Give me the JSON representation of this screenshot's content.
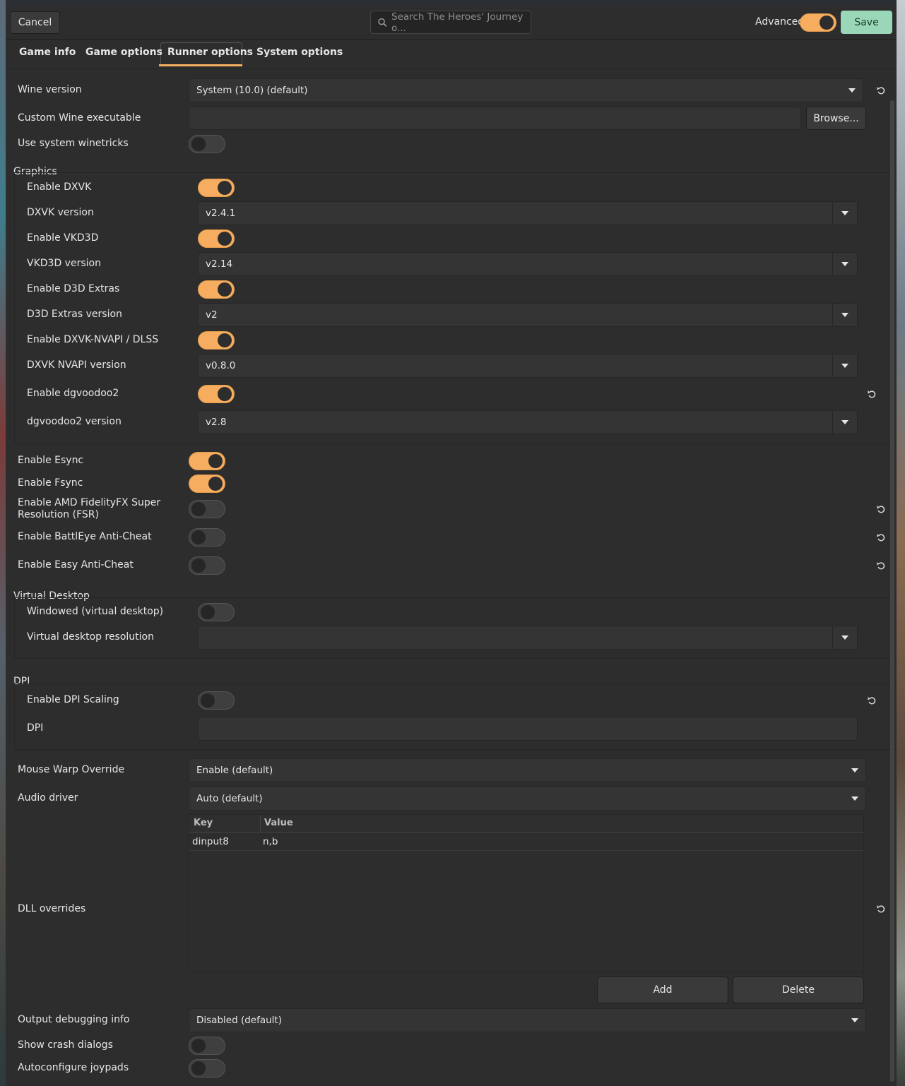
{
  "header": {
    "cancel_label": "Cancel",
    "search_placeholder": "Search The Heroes' Journey o...",
    "advanced_label": "Advanced",
    "advanced_on": true,
    "save_label": "Save"
  },
  "tabs": [
    {
      "label": "Game info"
    },
    {
      "label": "Game options"
    },
    {
      "label": "Runner options",
      "active": true
    },
    {
      "label": "System options"
    }
  ],
  "runner": {
    "wine_version_label": "Wine version",
    "wine_version_value": "System (10.0) (default)",
    "custom_wine_label": "Custom Wine executable",
    "custom_wine_value": "",
    "browse_label": "Browse...",
    "system_winetricks_label": "Use system winetricks",
    "system_winetricks_on": false
  },
  "graphics": {
    "title": "Graphics",
    "enable_dxvk_label": "Enable DXVK",
    "enable_dxvk_on": true,
    "dxvk_version_label": "DXVK version",
    "dxvk_version_value": "v2.4.1",
    "enable_vkd3d_label": "Enable VKD3D",
    "enable_vkd3d_on": true,
    "vkd3d_version_label": "VKD3D version",
    "vkd3d_version_value": "v2.14",
    "enable_d3d_extras_label": "Enable D3D Extras",
    "enable_d3d_extras_on": true,
    "d3d_extras_version_label": "D3D Extras version",
    "d3d_extras_version_value": "v2",
    "enable_nvapi_label": "Enable DXVK-NVAPI / DLSS",
    "enable_nvapi_on": true,
    "nvapi_version_label": "DXVK NVAPI version",
    "nvapi_version_value": "v0.8.0",
    "enable_dgvoodoo2_label": "Enable dgvoodoo2",
    "enable_dgvoodoo2_on": true,
    "dgvoodoo2_version_label": "dgvoodoo2 version",
    "dgvoodoo2_version_value": "v2.8"
  },
  "sync": {
    "esync_label": "Enable Esync",
    "esync_on": true,
    "fsync_label": "Enable Fsync",
    "fsync_on": true,
    "fsr_label_line1": "Enable AMD FidelityFX Super",
    "fsr_label_line2": "Resolution (FSR)",
    "fsr_on": false,
    "battleye_label": "Enable BattlEye Anti-Cheat",
    "battleye_on": false,
    "eac_label": "Enable Easy Anti-Cheat",
    "eac_on": false
  },
  "virtual_desktop": {
    "title": "Virtual Desktop",
    "windowed_label": "Windowed (virtual desktop)",
    "windowed_on": false,
    "resolution_label": "Virtual desktop resolution",
    "resolution_value": ""
  },
  "dpi": {
    "title": "DPI",
    "scaling_label": "Enable DPI Scaling",
    "scaling_on": false,
    "dpi_label": "DPI",
    "dpi_value": ""
  },
  "misc": {
    "mouse_warp_label": "Mouse Warp Override",
    "mouse_warp_value": "Enable (default)",
    "audio_driver_label": "Audio driver",
    "audio_driver_value": "Auto (default)",
    "dll_overrides_label": "DLL overrides",
    "dll_columns": [
      "Key",
      "Value"
    ],
    "dll_rows": [
      {
        "key": "dinput8",
        "value": "n,b"
      }
    ],
    "add_label": "Add",
    "delete_label": "Delete",
    "debug_label": "Output debugging info",
    "debug_value": "Disabled (default)",
    "crash_dialogs_label": "Show crash dialogs",
    "crash_dialogs_on": false,
    "joypads_label": "Autoconfigure joypads",
    "joypads_on": false
  },
  "colors": {
    "accent": "#f6ad5f",
    "save": "#9ad6b8",
    "background": "#2d2d2d"
  }
}
